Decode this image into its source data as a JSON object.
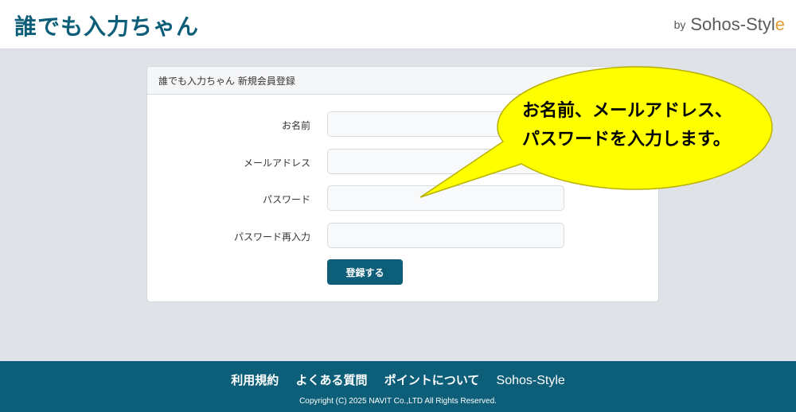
{
  "header": {
    "logo": "誰でも入力ちゃん",
    "brand_by": "by",
    "brand_name": "Sohos-Styl",
    "brand_last": "e"
  },
  "card": {
    "title": "誰でも入力ちゃん 新規会員登録",
    "fields": [
      {
        "label": "お名前",
        "value": ""
      },
      {
        "label": "メールアドレス",
        "value": ""
      },
      {
        "label": "パスワード",
        "value": ""
      },
      {
        "label": "パスワード再入力",
        "value": ""
      }
    ],
    "submit_label": "登録する"
  },
  "callout": {
    "line1": "お名前、メールアドレス、",
    "line2": "パスワードを入力します。",
    "fill": "#ffff00"
  },
  "footer": {
    "links": [
      "利用規約",
      "よくある質問",
      "ポイントについて",
      "Sohos-Style"
    ],
    "copyright": "Copyright (C) 2025 NAVIT Co.,LTD All Rights Reserved."
  }
}
